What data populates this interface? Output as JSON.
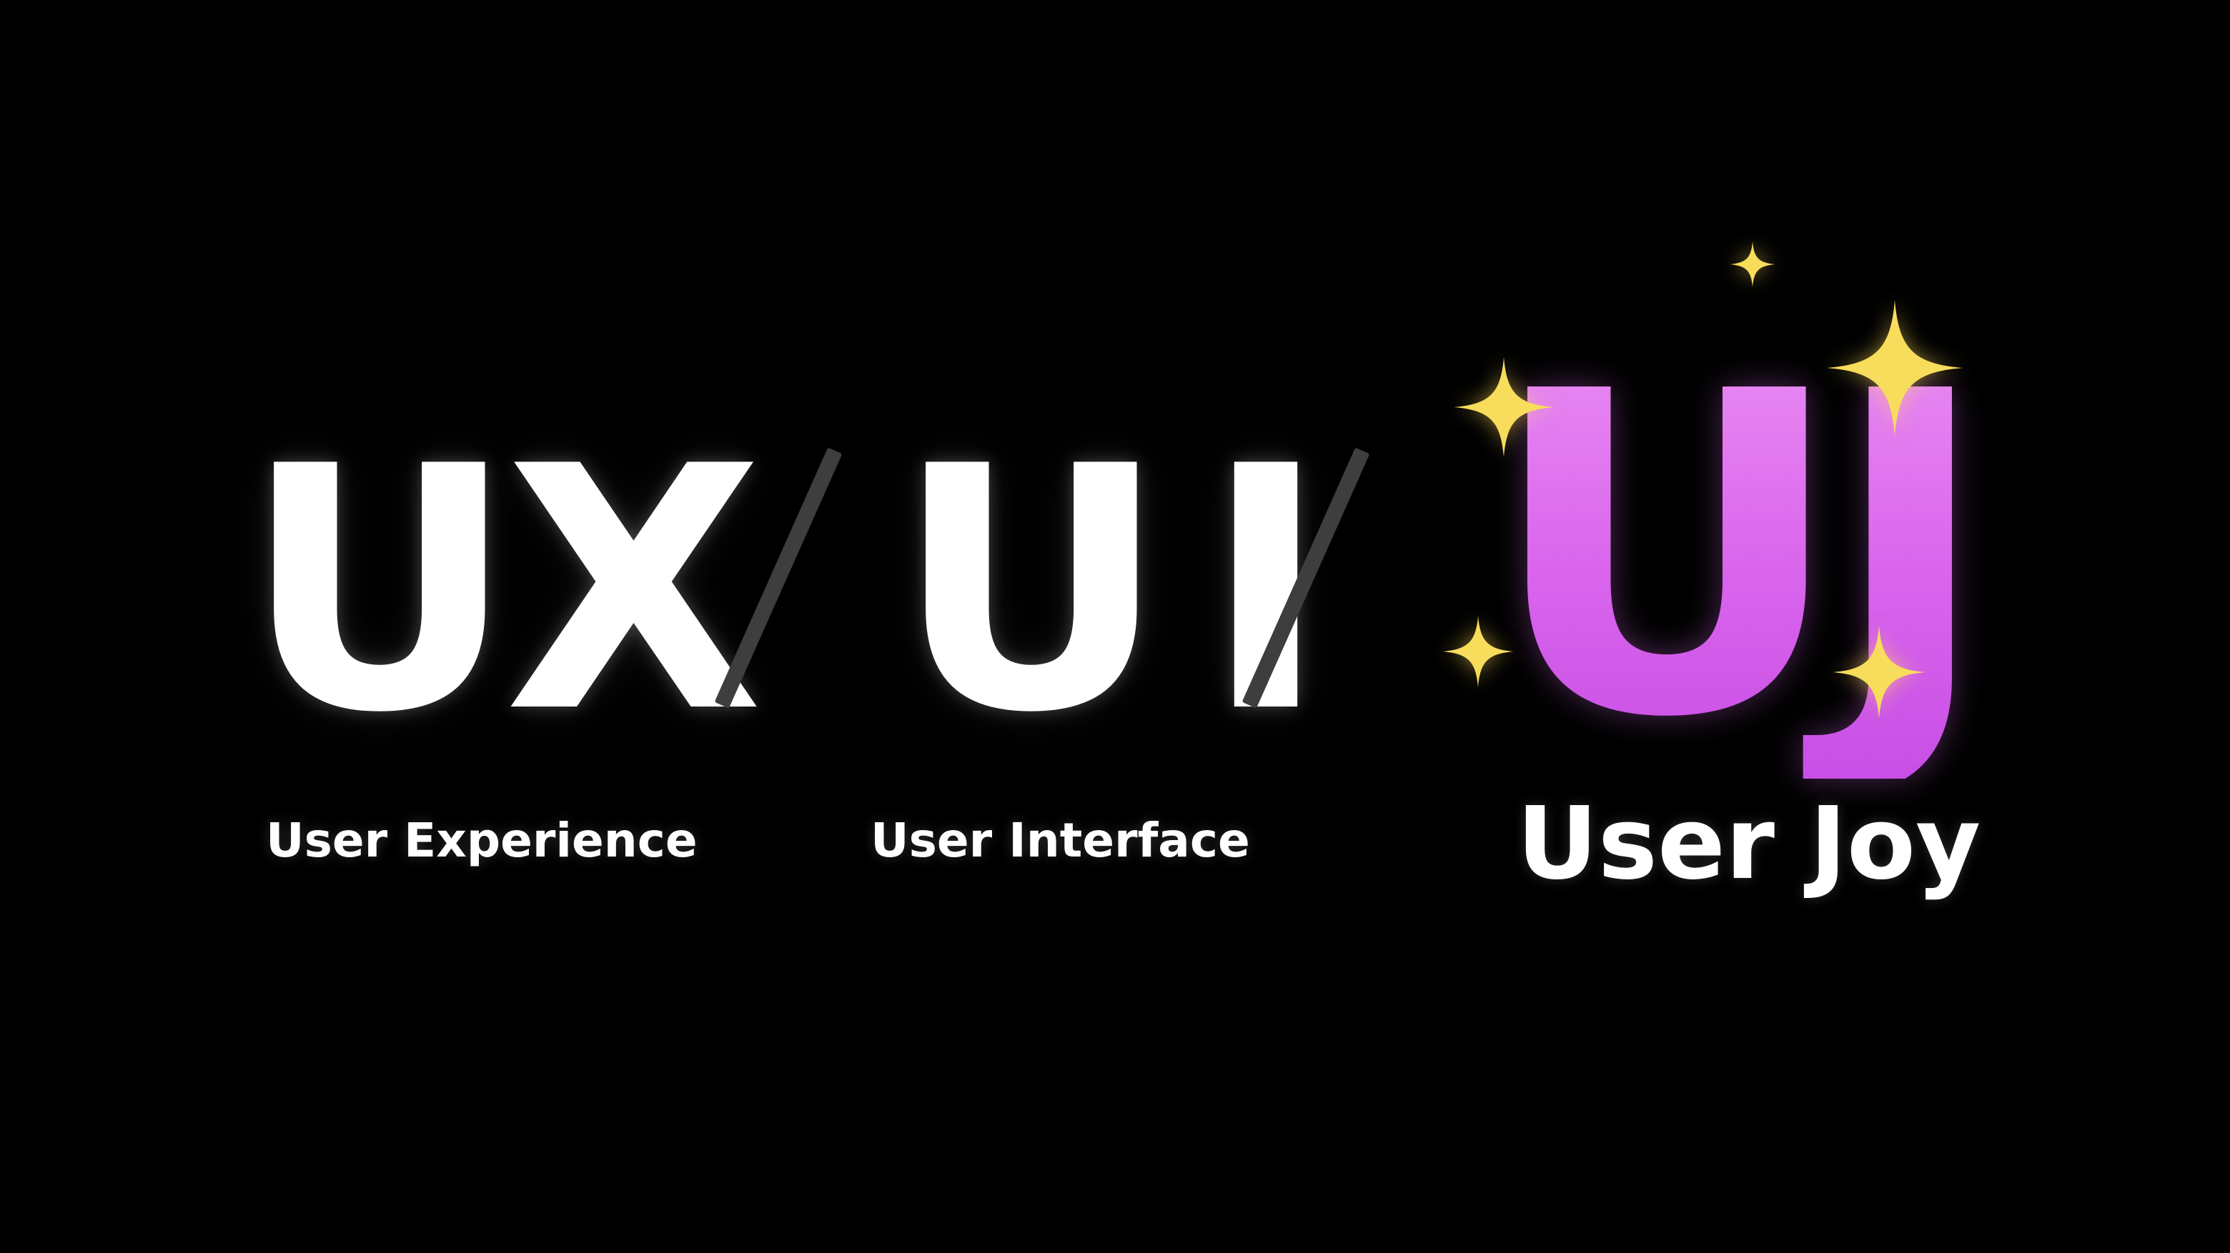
{
  "items": [
    {
      "abbr": "UX",
      "caption": "User Experience"
    },
    {
      "abbr": "UI",
      "caption": "User Interface"
    },
    {
      "abbr": "UJ",
      "caption": "User Joy"
    }
  ],
  "colors": {
    "background": "#000000",
    "text": "#ffffff",
    "separator": "#3e3e3e",
    "accent_gradient": [
      "#e98cf3",
      "#c84fe6"
    ],
    "sparkle": "#f8dd5c"
  },
  "icons": [
    "separator-slash",
    "sparkle-icon"
  ]
}
